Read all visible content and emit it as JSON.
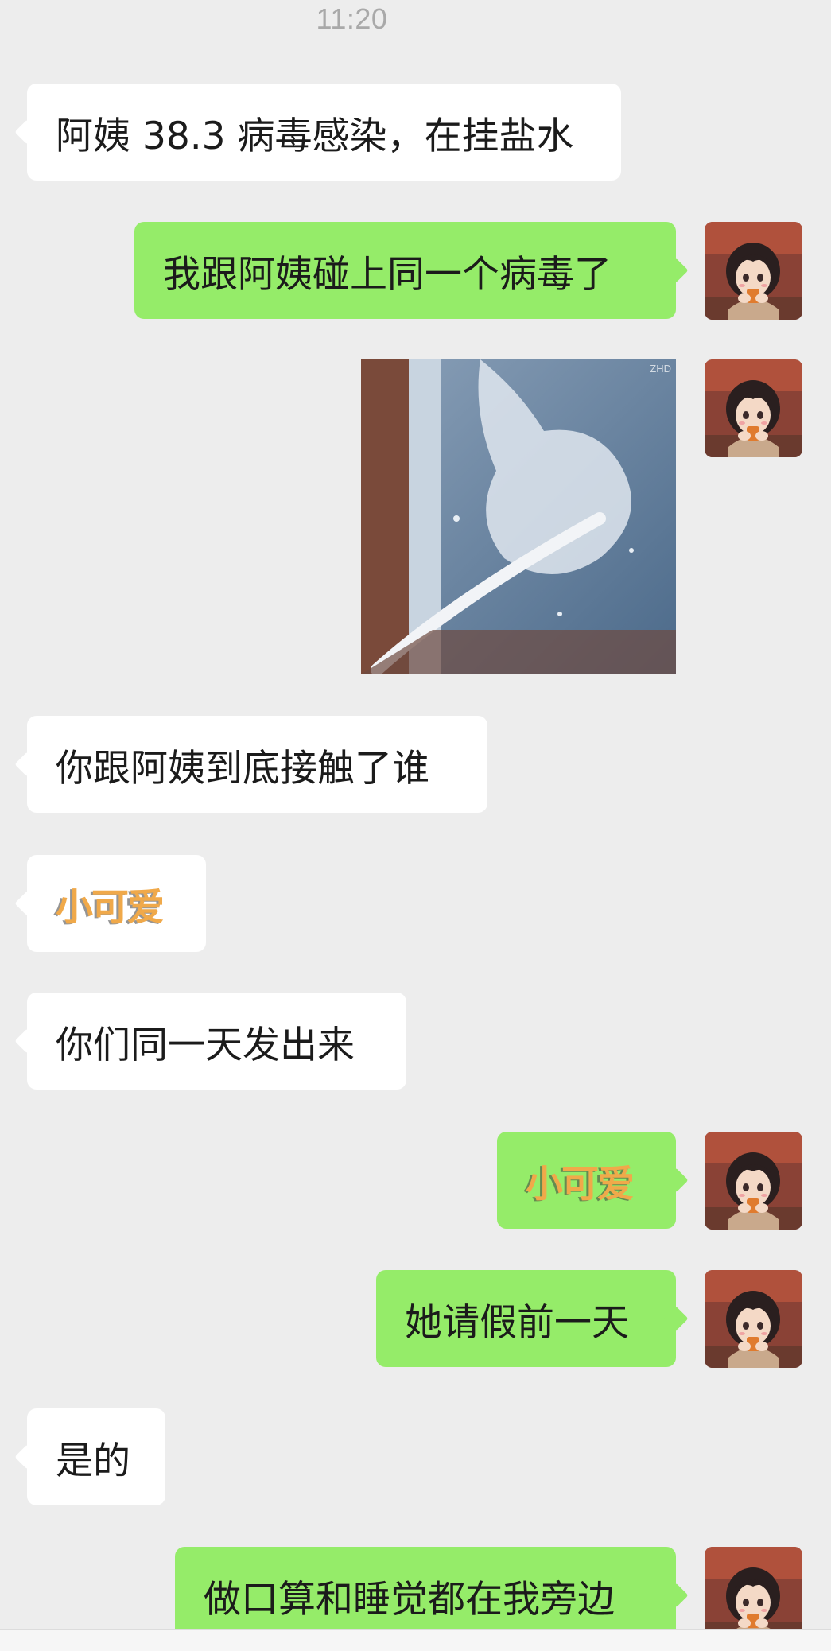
{
  "status": {
    "time": "11:20"
  },
  "messages": [
    {
      "side": "left",
      "type": "text",
      "text": "阿姨 38.3 病毒感染，在挂盐水"
    },
    {
      "side": "right",
      "type": "text",
      "text": "我跟阿姨碰上同一个病毒了"
    },
    {
      "side": "right",
      "type": "image",
      "text": ""
    },
    {
      "side": "left",
      "type": "text",
      "text": "你跟阿姨到底接触了谁"
    },
    {
      "side": "left",
      "type": "sticker",
      "text": "小可爱"
    },
    {
      "side": "left",
      "type": "text",
      "text": "你们同一天发出来"
    },
    {
      "side": "right",
      "type": "sticker",
      "text": "小可爱"
    },
    {
      "side": "right",
      "type": "text",
      "text": "她请假前一天"
    },
    {
      "side": "left",
      "type": "text",
      "text": "是的"
    },
    {
      "side": "right",
      "type": "text",
      "text": "做口算和睡觉都在我旁边"
    }
  ],
  "image_watermark": "ZHD",
  "colors": {
    "background": "#ededed",
    "bubble_left": "#ffffff",
    "bubble_right": "#95ec69",
    "timestamp": "#a9a9a9"
  },
  "icons": {
    "avatar": "user-avatar-anime-girl"
  }
}
